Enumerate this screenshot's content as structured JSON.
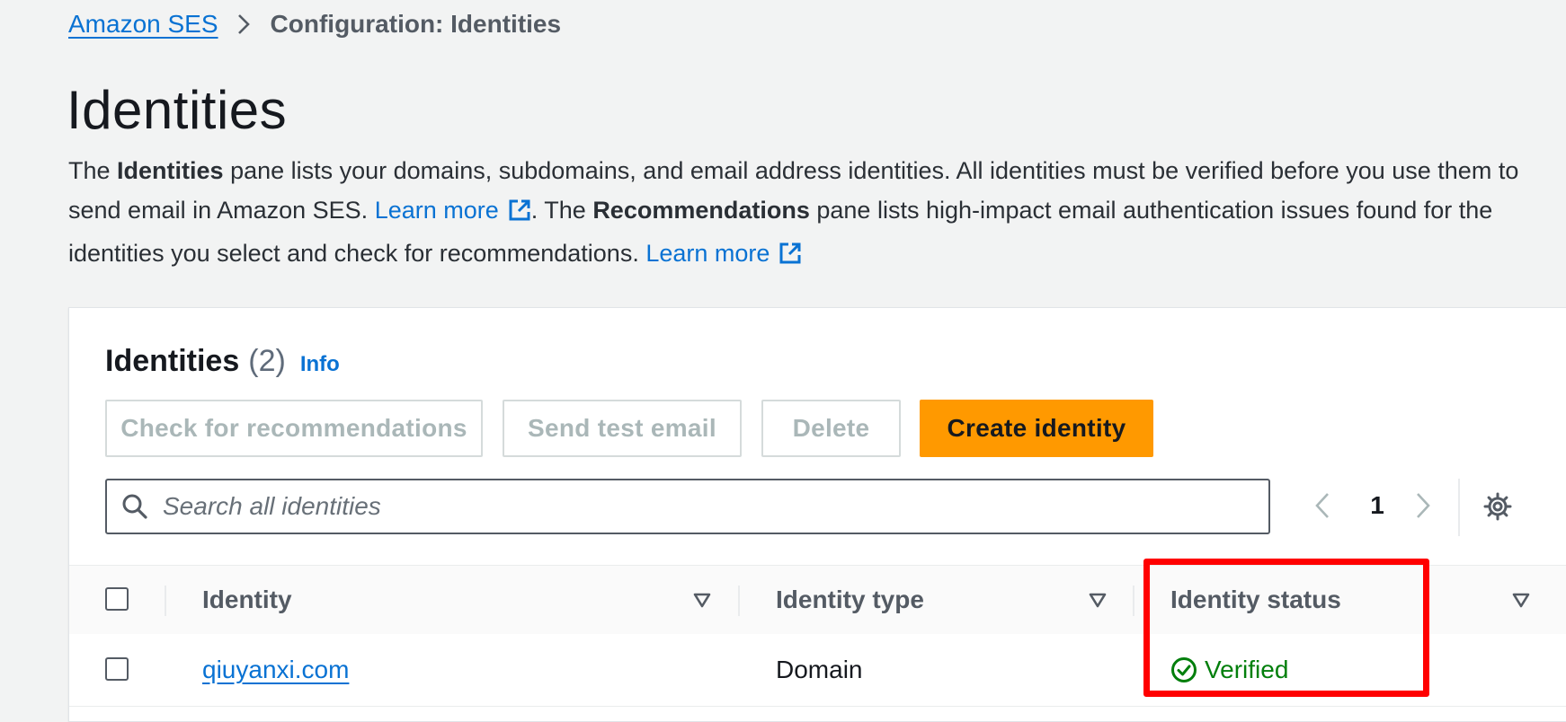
{
  "breadcrumb": {
    "root": "Amazon SES",
    "current": "Configuration: Identities"
  },
  "page": {
    "title": "Identities",
    "description": {
      "p1": "The ",
      "b1": "Identities",
      "p2": " pane lists your domains, subdomains, and email address identities. All identities must be verified before you use them to send email in Amazon SES. ",
      "link1": "Learn more",
      "p3": ". The ",
      "b2": "Recommendations",
      "p4": " pane lists high-impact email authentication issues found for the identities you select and check for recommendations. ",
      "link2": "Learn more"
    }
  },
  "panel": {
    "title": "Identities",
    "count": "(2)",
    "info": "Info",
    "buttons": {
      "check": "Check for recommendations",
      "send": "Send test email",
      "delete": "Delete",
      "create": "Create identity"
    },
    "search_placeholder": "Search all identities",
    "pagination": {
      "current": "1"
    },
    "columns": {
      "identity": "Identity",
      "type": "Identity type",
      "status": "Identity status"
    },
    "rows": [
      {
        "identity": "qiuyanxi.com",
        "type": "Domain",
        "status": "Verified"
      }
    ]
  },
  "colors": {
    "link": "#0972d3",
    "primary_button": "#ff9900",
    "success": "#037f0c",
    "highlight": "#ff0000"
  },
  "icons": [
    "chevron-right-icon",
    "external-link-icon",
    "search-icon",
    "chevron-left-icon",
    "gear-icon",
    "sort-caret-icon",
    "check-circle-icon"
  ]
}
